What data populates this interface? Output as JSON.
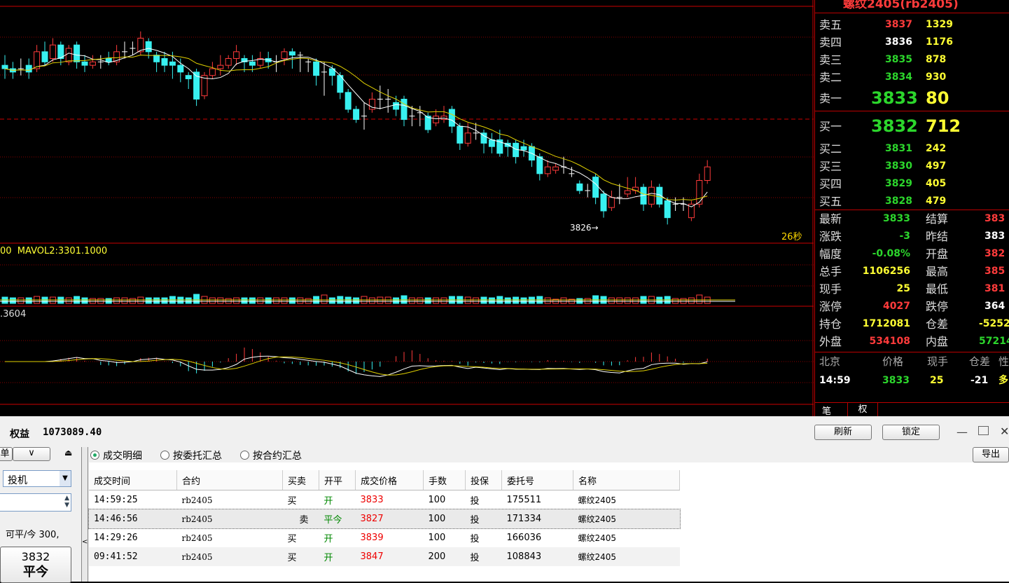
{
  "instrument_title": "螺纹2405(rb2405)",
  "chart": {
    "price_marker": "3826",
    "countdown": "26秒",
    "vol_label": "00  MAVOL2:3301.1000",
    "macd_label": ".3604",
    "candles": [
      {
        "o": 3849,
        "c": 3848,
        "h": 3852,
        "l": 3845
      },
      {
        "o": 3848,
        "c": 3847,
        "h": 3850,
        "l": 3845
      },
      {
        "o": 3848,
        "c": 3848,
        "h": 3851,
        "l": 3846
      },
      {
        "o": 3849,
        "c": 3847,
        "h": 3851,
        "l": 3845
      },
      {
        "o": 3848,
        "c": 3853,
        "h": 3855,
        "l": 3847
      },
      {
        "o": 3853,
        "c": 3850,
        "h": 3856,
        "l": 3849
      },
      {
        "o": 3851,
        "c": 3855,
        "h": 3857,
        "l": 3850
      },
      {
        "o": 3855,
        "c": 3851,
        "h": 3856,
        "l": 3849
      },
      {
        "o": 3850,
        "c": 3854,
        "h": 3855,
        "l": 3849
      },
      {
        "o": 3855,
        "c": 3850,
        "h": 3856,
        "l": 3848
      },
      {
        "o": 3850,
        "c": 3849,
        "h": 3852,
        "l": 3847
      },
      {
        "o": 3849,
        "c": 3850,
        "h": 3852,
        "l": 3848
      },
      {
        "o": 3850,
        "c": 3850,
        "h": 3852,
        "l": 3848
      },
      {
        "o": 3851,
        "c": 3850,
        "h": 3853,
        "l": 3849
      },
      {
        "o": 3850,
        "c": 3853,
        "h": 3855,
        "l": 3849
      },
      {
        "o": 3853,
        "c": 3853,
        "h": 3856,
        "l": 3851
      },
      {
        "o": 3854,
        "c": 3854,
        "h": 3856,
        "l": 3852
      },
      {
        "o": 3853,
        "c": 3857,
        "h": 3859,
        "l": 3852
      },
      {
        "o": 3856,
        "c": 3853,
        "h": 3857,
        "l": 3851
      },
      {
        "o": 3852,
        "c": 3850,
        "h": 3853,
        "l": 3847
      },
      {
        "o": 3851,
        "c": 3849,
        "h": 3853,
        "l": 3847
      },
      {
        "o": 3850,
        "c": 3849,
        "h": 3853,
        "l": 3845
      },
      {
        "o": 3849,
        "c": 3847,
        "h": 3851,
        "l": 3844
      },
      {
        "o": 3846,
        "c": 3845,
        "h": 3847,
        "l": 3842
      },
      {
        "o": 3847,
        "c": 3839,
        "h": 3848,
        "l": 3837
      },
      {
        "o": 3840,
        "c": 3846,
        "h": 3847,
        "l": 3839
      },
      {
        "o": 3846,
        "c": 3848,
        "h": 3850,
        "l": 3845
      },
      {
        "o": 3848,
        "c": 3849,
        "h": 3852,
        "l": 3846
      },
      {
        "o": 3849,
        "c": 3851,
        "h": 3852,
        "l": 3848
      },
      {
        "o": 3851,
        "c": 3853,
        "h": 3855,
        "l": 3849
      },
      {
        "o": 3851,
        "c": 3850,
        "h": 3852,
        "l": 3847
      },
      {
        "o": 3850,
        "c": 3849,
        "h": 3852,
        "l": 3847
      },
      {
        "o": 3849,
        "c": 3851,
        "h": 3853,
        "l": 3848
      },
      {
        "o": 3851,
        "c": 3850,
        "h": 3853,
        "l": 3848
      },
      {
        "o": 3850,
        "c": 3850,
        "h": 3852,
        "l": 3847
      },
      {
        "o": 3851,
        "c": 3853,
        "h": 3854,
        "l": 3849
      },
      {
        "o": 3853,
        "c": 3852,
        "h": 3854,
        "l": 3848
      },
      {
        "o": 3852,
        "c": 3852,
        "h": 3853,
        "l": 3847
      },
      {
        "o": 3850,
        "c": 3850,
        "h": 3851,
        "l": 3847
      },
      {
        "o": 3850,
        "c": 3846,
        "h": 3851,
        "l": 3843
      },
      {
        "o": 3847,
        "c": 3847,
        "h": 3850,
        "l": 3840
      },
      {
        "o": 3848,
        "c": 3846,
        "h": 3849,
        "l": 3843
      },
      {
        "o": 3846,
        "c": 3841,
        "h": 3847,
        "l": 3839
      },
      {
        "o": 3841,
        "c": 3836,
        "h": 3842,
        "l": 3835
      },
      {
        "o": 3836,
        "c": 3833,
        "h": 3837,
        "l": 3832
      },
      {
        "o": 3834,
        "c": 3834,
        "h": 3838,
        "l": 3830
      },
      {
        "o": 3836,
        "c": 3839,
        "h": 3841,
        "l": 3835
      },
      {
        "o": 3839,
        "c": 3839,
        "h": 3843,
        "l": 3836
      },
      {
        "o": 3839,
        "c": 3839,
        "h": 3842,
        "l": 3835
      },
      {
        "o": 3838,
        "c": 3836,
        "h": 3840,
        "l": 3834
      },
      {
        "o": 3839,
        "c": 3833,
        "h": 3840,
        "l": 3831
      },
      {
        "o": 3834,
        "c": 3834,
        "h": 3837,
        "l": 3831
      },
      {
        "o": 3835,
        "c": 3835,
        "h": 3837,
        "l": 3831
      },
      {
        "o": 3834,
        "c": 3830,
        "h": 3835,
        "l": 3829
      },
      {
        "o": 3832,
        "c": 3834,
        "h": 3836,
        "l": 3831
      },
      {
        "o": 3833,
        "c": 3834,
        "h": 3837,
        "l": 3832
      },
      {
        "o": 3836,
        "c": 3831,
        "h": 3837,
        "l": 3829
      },
      {
        "o": 3831,
        "c": 3826,
        "h": 3832,
        "l": 3824
      },
      {
        "o": 3826,
        "c": 3829,
        "h": 3832,
        "l": 3825
      },
      {
        "o": 3829,
        "c": 3829,
        "h": 3832,
        "l": 3827
      },
      {
        "o": 3829,
        "c": 3826,
        "h": 3830,
        "l": 3823
      },
      {
        "o": 3827,
        "c": 3825,
        "h": 3829,
        "l": 3823
      },
      {
        "o": 3827,
        "c": 3823,
        "h": 3830,
        "l": 3822
      },
      {
        "o": 3826,
        "c": 3825,
        "h": 3827,
        "l": 3822
      },
      {
        "o": 3826,
        "c": 3822,
        "h": 3827,
        "l": 3820
      },
      {
        "o": 3825,
        "c": 3824,
        "h": 3827,
        "l": 3822
      },
      {
        "o": 3825,
        "c": 3821,
        "h": 3826,
        "l": 3819
      },
      {
        "o": 3822,
        "c": 3817,
        "h": 3823,
        "l": 3815
      },
      {
        "o": 3817,
        "c": 3819,
        "h": 3821,
        "l": 3816
      },
      {
        "o": 3818,
        "c": 3819,
        "h": 3820,
        "l": 3817
      },
      {
        "o": 3819,
        "c": 3819,
        "h": 3822,
        "l": 3817
      },
      {
        "o": 3817,
        "c": 3817,
        "h": 3819,
        "l": 3816
      },
      {
        "o": 3814,
        "c": 3812,
        "h": 3815,
        "l": 3811
      },
      {
        "o": 3812,
        "c": 3812,
        "h": 3814,
        "l": 3810
      },
      {
        "o": 3816,
        "c": 3810,
        "h": 3817,
        "l": 3808
      },
      {
        "o": 3811,
        "c": 3806,
        "h": 3812,
        "l": 3804
      },
      {
        "o": 3807,
        "c": 3810,
        "h": 3812,
        "l": 3806
      },
      {
        "o": 3810,
        "c": 3810,
        "h": 3814,
        "l": 3808
      },
      {
        "o": 3811,
        "c": 3812,
        "h": 3816,
        "l": 3810
      },
      {
        "o": 3812,
        "c": 3813,
        "h": 3816,
        "l": 3811
      },
      {
        "o": 3813,
        "c": 3808,
        "h": 3814,
        "l": 3806
      },
      {
        "o": 3808,
        "c": 3813,
        "h": 3815,
        "l": 3807
      },
      {
        "o": 3813,
        "c": 3808,
        "h": 3814,
        "l": 3807
      },
      {
        "o": 3809,
        "c": 3804,
        "h": 3810,
        "l": 3802
      },
      {
        "o": 3808,
        "c": 3808,
        "h": 3810,
        "l": 3806
      },
      {
        "o": 3808,
        "c": 3808,
        "h": 3810,
        "l": 3806
      },
      {
        "o": 3804,
        "c": 3808,
        "h": 3809,
        "l": 3803
      },
      {
        "o": 3808,
        "c": 3815,
        "h": 3817,
        "l": 3807
      },
      {
        "o": 3815,
        "c": 3819,
        "h": 3821,
        "l": 3814
      }
    ]
  },
  "quote": {
    "asks": [
      {
        "label": "卖五",
        "price": "3837",
        "vol": "1329"
      },
      {
        "label": "卖四",
        "price": "3836",
        "vol": "1176"
      },
      {
        "label": "卖三",
        "price": "3835",
        "vol": "878"
      },
      {
        "label": "卖二",
        "price": "3834",
        "vol": "930"
      },
      {
        "label": "卖一",
        "price": "3833",
        "vol": "80"
      }
    ],
    "bids": [
      {
        "label": "买一",
        "price": "3832",
        "vol": "712"
      },
      {
        "label": "买二",
        "price": "3831",
        "vol": "242"
      },
      {
        "label": "买三",
        "price": "3830",
        "vol": "497"
      },
      {
        "label": "买四",
        "price": "3829",
        "vol": "405"
      },
      {
        "label": "买五",
        "price": "3828",
        "vol": "479"
      }
    ],
    "stats": [
      {
        "l1": "最新",
        "v1": "3833",
        "l2": "结算",
        "v2": "383"
      },
      {
        "l1": "涨跌",
        "v1": "-3",
        "l2": "昨结",
        "v2": "383"
      },
      {
        "l1": "幅度",
        "v1": "-0.08%",
        "l2": "开盘",
        "v2": "382"
      },
      {
        "l1": "总手",
        "v1": "1106256",
        "l2": "最高",
        "v2": "385"
      },
      {
        "l1": "现手",
        "v1": "25",
        "l2": "最低",
        "v2": "381"
      },
      {
        "l1": "涨停",
        "v1": "4027",
        "l2": "跌停",
        "v2": "364"
      },
      {
        "l1": "持仓",
        "v1": "1712081",
        "l2": "仓差",
        "v2": "-5252"
      },
      {
        "l1": "外盘",
        "v1": "534108",
        "l2": "内盘",
        "v2": "57214"
      }
    ],
    "tick_header": {
      "c1": "北京",
      "c2": "价格",
      "c3": "现手",
      "c4": "仓差",
      "c5": "性"
    },
    "tick_row": {
      "time": "14:59",
      "price": "3833",
      "vol": "25",
      "diff": "-21",
      "nature": "多"
    },
    "tabs": {
      "t1": "笔",
      "t2": "权"
    }
  },
  "bottom": {
    "equity_label": "权益",
    "equity_value": "1073089.40",
    "btn_refresh": "刷新",
    "btn_lock": "锁定",
    "btn_export": "导出",
    "left_btn1": "单",
    "select_hedge": "投机",
    "position_text": "可平/今 300,",
    "price_btn": "3832",
    "price_btn_sub": "平今",
    "radios": [
      "成交明细",
      "按委托汇总",
      "按合约汇总"
    ],
    "columns": [
      "成交时间",
      "合约",
      "买卖",
      "开平",
      "成交价格",
      "手数",
      "投保",
      "委托号",
      "名称"
    ],
    "rows": [
      {
        "time": "14:59:25",
        "contract": "rb2405",
        "side": "买",
        "oc": "开",
        "price": "3833",
        "qty": "100",
        "hedge": "投",
        "order": "175511",
        "name": "螺纹2405"
      },
      {
        "time": "14:46:56",
        "contract": "rb2405",
        "side": "卖",
        "oc": "平今",
        "price": "3827",
        "qty": "100",
        "hedge": "投",
        "order": "171334",
        "name": "螺纹2405"
      },
      {
        "time": "14:29:26",
        "contract": "rb2405",
        "side": "买",
        "oc": "开",
        "price": "3839",
        "qty": "100",
        "hedge": "投",
        "order": "166036",
        "name": "螺纹2405"
      },
      {
        "time": "09:41:52",
        "contract": "rb2405",
        "side": "买",
        "oc": "开",
        "price": "3847",
        "qty": "200",
        "hedge": "投",
        "order": "108843",
        "name": "螺纹2405"
      }
    ]
  },
  "colors": {
    "up": "#ff3b3b",
    "down": "#38f0f0",
    "ma1": "#ffffff",
    "ma2": "#e0d000",
    "grid": "#8a0000"
  }
}
